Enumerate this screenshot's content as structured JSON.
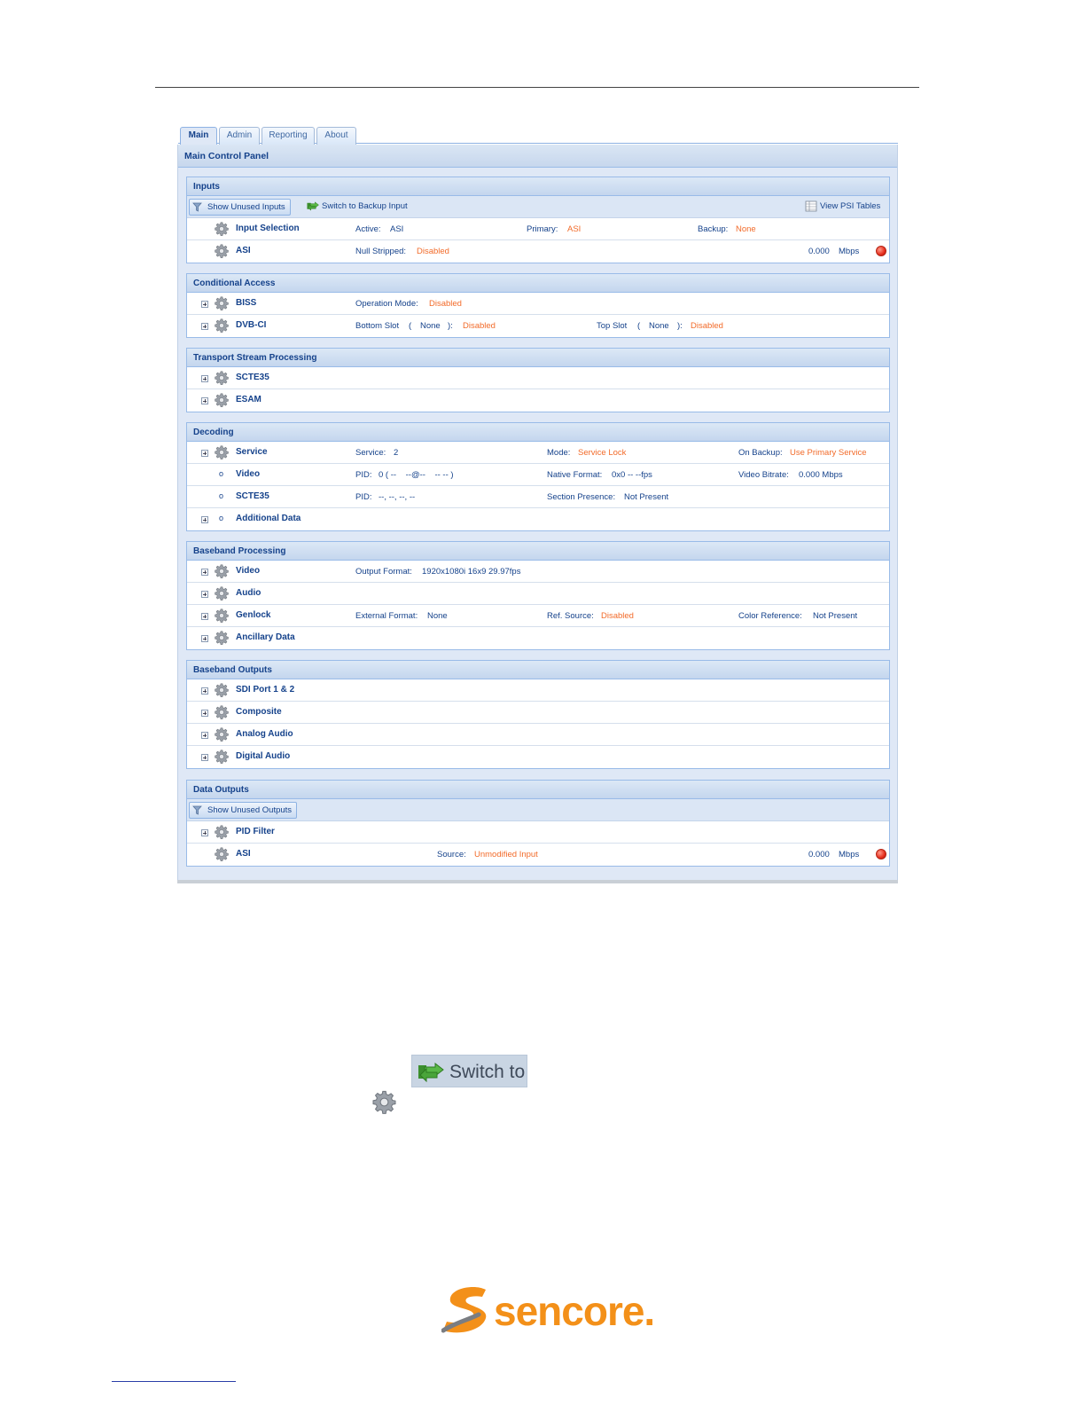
{
  "tabs": [
    {
      "label": "Main",
      "active": true
    },
    {
      "label": "Admin",
      "active": false
    },
    {
      "label": "Reporting",
      "active": false
    },
    {
      "label": "About",
      "active": false
    }
  ],
  "panel_title": "Main Control Panel",
  "inputs": {
    "title": "Inputs",
    "show_unused": "Show Unused Inputs",
    "switch_backup": "Switch to Backup Input",
    "view_psi": "View PSI Tables",
    "input_selection": {
      "name": "Input Selection",
      "active_label": "Active:",
      "active_val": "ASI",
      "primary_label": "Primary:",
      "primary_val": "ASI",
      "backup_label": "Backup:",
      "backup_val": "None"
    },
    "asi": {
      "name": "ASI",
      "null_label": "Null Stripped:",
      "null_val": "Disabled",
      "rate": "0.000",
      "unit": "Mbps"
    }
  },
  "conditional_access": {
    "title": "Conditional Access",
    "biss": {
      "name": "BISS",
      "mode_label": "Operation Mode:",
      "mode_val": "Disabled"
    },
    "dvbci": {
      "name": "DVB-CI",
      "bottom_label": "Bottom Slot",
      "open1": "(",
      "bottom_slot": "None",
      "close1": "):",
      "bottom_val": "Disabled",
      "top_label": "Top Slot",
      "open2": "(",
      "top_slot": "None",
      "close2": "):",
      "top_val": "Disabled"
    }
  },
  "ts_processing": {
    "title": "Transport Stream Processing",
    "items": [
      "SCTE35",
      "ESAM"
    ]
  },
  "decoding": {
    "title": "Decoding",
    "service": {
      "name": "Service",
      "svc_label": "Service:",
      "svc_val": "2",
      "mode_label": "Mode:",
      "mode_val": "Service Lock",
      "backup_label": "On Backup:",
      "backup_val": "Use Primary Service"
    },
    "video": {
      "name": "Video",
      "pid_label": "PID:",
      "pid_val": "0 ( --    --@--    -- -- )",
      "format_label": "Native Format:",
      "format_val": "0x0 -- --fps",
      "bitrate_label": "Video Bitrate:",
      "bitrate_val": "0.000 Mbps"
    },
    "scte35": {
      "name": "SCTE35",
      "pid_label": "PID:",
      "pid_val": "--, --, --, --",
      "presence_label": "Section Presence:",
      "presence_val": "Not Present"
    },
    "additional": {
      "name": "Additional Data"
    }
  },
  "baseband_processing": {
    "title": "Baseband Processing",
    "video": {
      "name": "Video",
      "format_label": "Output Format:",
      "format_val": "1920x1080i 16x9 29.97fps"
    },
    "audio": {
      "name": "Audio"
    },
    "genlock": {
      "name": "Genlock",
      "ext_label": "External Format:",
      "ext_val": "None",
      "ref_label": "Ref. Source:",
      "ref_val": "Disabled",
      "color_label": "Color Reference:",
      "color_val": "Not Present"
    },
    "ancillary": {
      "name": "Ancillary Data"
    }
  },
  "baseband_outputs": {
    "title": "Baseband Outputs",
    "items": [
      "SDI Port 1 & 2",
      "Composite",
      "Analog Audio",
      "Digital Audio"
    ]
  },
  "data_outputs": {
    "title": "Data Outputs",
    "show_unused": "Show Unused Outputs",
    "pid_filter": {
      "name": "PID Filter"
    },
    "asi": {
      "name": "ASI",
      "source_label": "Source:",
      "source_val": "Unmodified Input",
      "rate": "0.000",
      "unit": "Mbps"
    }
  },
  "switch_button_image": "Switch to",
  "logo_text": "sencore.",
  "colors": {
    "accent_text": "#15428b",
    "status_orange": "#f26b2a",
    "header_bg": "#dfe8f6",
    "status_red": "#e62e1d",
    "logo_orange": "#f39019"
  },
  "icons": [
    "gear-icon",
    "expander-icon",
    "switch-icon",
    "psi-table-icon",
    "status-red-icon"
  ]
}
